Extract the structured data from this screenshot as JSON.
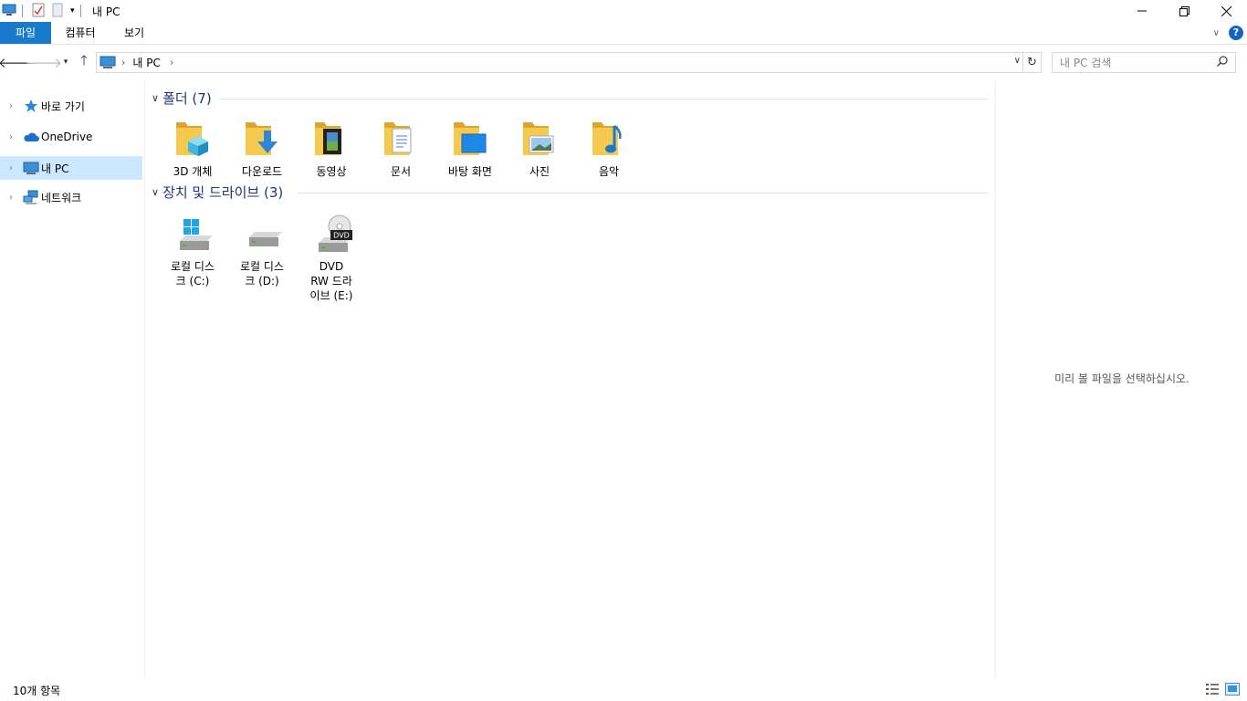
{
  "window": {
    "title": "내 PC"
  },
  "ribbon": {
    "tabs": [
      "파일",
      "컴퓨터",
      "보기"
    ]
  },
  "address": {
    "crumb": "내 PC"
  },
  "search": {
    "placeholder": "내 PC 검색"
  },
  "sidebar": {
    "items": [
      {
        "label": "바로 가기",
        "icon": "star-icon"
      },
      {
        "label": "OneDrive",
        "icon": "cloud-icon"
      },
      {
        "label": "내 PC",
        "icon": "computer-icon",
        "selected": true
      },
      {
        "label": "네트워크",
        "icon": "network-icon"
      }
    ]
  },
  "groups": {
    "folders": {
      "title": "폴더 (7)",
      "items": [
        {
          "label": "3D 개체",
          "icon": "3d-objects-folder-icon"
        },
        {
          "label": "다운로드",
          "icon": "downloads-folder-icon"
        },
        {
          "label": "동영상",
          "icon": "videos-folder-icon"
        },
        {
          "label": "문서",
          "icon": "documents-folder-icon"
        },
        {
          "label": "바탕 화면",
          "icon": "desktop-folder-icon"
        },
        {
          "label": "사진",
          "icon": "pictures-folder-icon"
        },
        {
          "label": "음악",
          "icon": "music-folder-icon"
        }
      ]
    },
    "drives": {
      "title": "장치 및 드라이브 (3)",
      "items": [
        {
          "label": "로컬 디스크 (C:)",
          "icon": "windows-drive-icon"
        },
        {
          "label": "로컬 디스크 (D:)",
          "icon": "hard-drive-icon"
        },
        {
          "label": "DVD RW 드라이브 (E:)",
          "icon": "dvd-drive-icon",
          "badge": "DVD"
        }
      ]
    }
  },
  "preview": {
    "message": "미리 볼 파일을 선택하십시오."
  },
  "status": {
    "count": "10개 항목"
  },
  "colors": {
    "accent": "#1979ca",
    "selected": "#cce8ff",
    "group_title": "#1e3287",
    "folder": "#f5c94e"
  }
}
